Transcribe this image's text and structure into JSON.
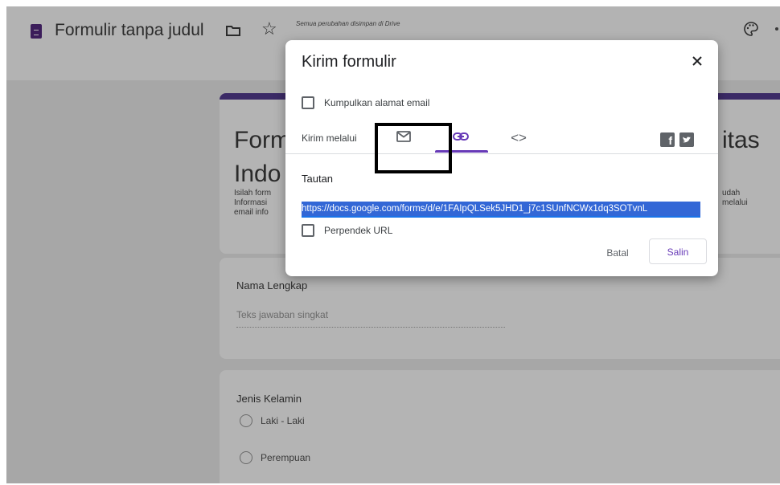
{
  "header": {
    "title": "Formulir tanpa judul",
    "save_status": "Semua perubahan disimpan di Drive",
    "icons": [
      "docs-form-icon",
      "folder-icon",
      "star-icon",
      "palette-icon",
      "more-icon"
    ]
  },
  "background_form": {
    "title_left": "Form\nIndo",
    "title_right": "itas",
    "desc_left": "Isilah form\nInformasi\nemail info",
    "desc_right": "udah\nmelalui",
    "questions": [
      {
        "label": "Nama Lengkap",
        "answer_placeholder": "Teks jawaban singkat"
      },
      {
        "label": "Jenis Kelamin",
        "options": [
          "Laki - Laki",
          "Perempuan"
        ]
      }
    ]
  },
  "dialog": {
    "title": "Kirim formulir",
    "collect_email_label": "Kumpulkan alamat email",
    "send_via_label": "Kirim melalui",
    "tabs": [
      {
        "name": "email",
        "icon": "mail-icon"
      },
      {
        "name": "link",
        "icon": "link-icon",
        "active": true
      },
      {
        "name": "embed",
        "icon": "code-icon",
        "glyph": "<>"
      }
    ],
    "share_icons": [
      "facebook-icon",
      "twitter-icon"
    ],
    "link_label": "Tautan",
    "link_value": "https://docs.google.com/forms/d/e/1FAIpQLSek5JHD1_j7c1SUnfNCWx1dq3SOTvnL",
    "shorten_label": "Perpendek URL",
    "cancel_label": "Batal",
    "copy_label": "Salin"
  },
  "colors": {
    "accent": "#673ab7",
    "link_highlight": "#3367d6",
    "backdrop": "#a7a7a7"
  }
}
